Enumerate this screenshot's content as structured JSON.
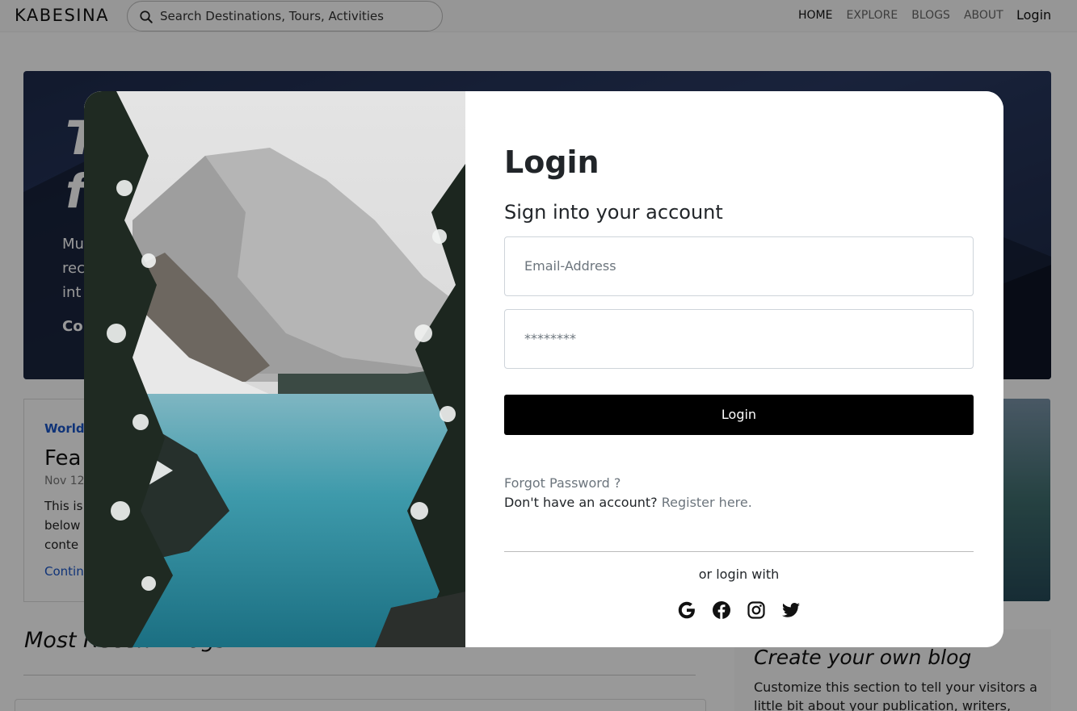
{
  "navbar": {
    "brand": "KABESINA",
    "search_placeholder": "Search Destinations, Tours, Activities",
    "links": [
      "HOME",
      "EXPLORE",
      "BLOGS",
      "ABOUT"
    ],
    "login": "Login"
  },
  "hero": {
    "title_line1": "T",
    "title_line2": "f",
    "sub_line1": "Mu",
    "sub_line2": "rec",
    "sub_line3": "int",
    "cta": "Co"
  },
  "featured": {
    "category": "World",
    "title": "Fea",
    "date": "Nov 12",
    "text_line1": "This is",
    "text_line2": "below",
    "text_line3": "conte",
    "link": "Contin"
  },
  "recent": {
    "title": "Most Recent Blogs"
  },
  "create": {
    "title": "Create your own blog",
    "text": "Customize this section to tell your visitors a little bit about your publication, writers,"
  },
  "modal": {
    "title": "Login",
    "subtitle": "Sign into your account",
    "email_placeholder": "Email-Address",
    "password_placeholder": "********",
    "login_button": "Login",
    "forgot": "Forgot Password ?",
    "no_account": "Don't have an account?",
    "register": "Register here.",
    "or_login_with": "or login with",
    "social_icons": [
      "google-icon",
      "facebook-icon",
      "instagram-icon",
      "twitter-icon"
    ]
  }
}
